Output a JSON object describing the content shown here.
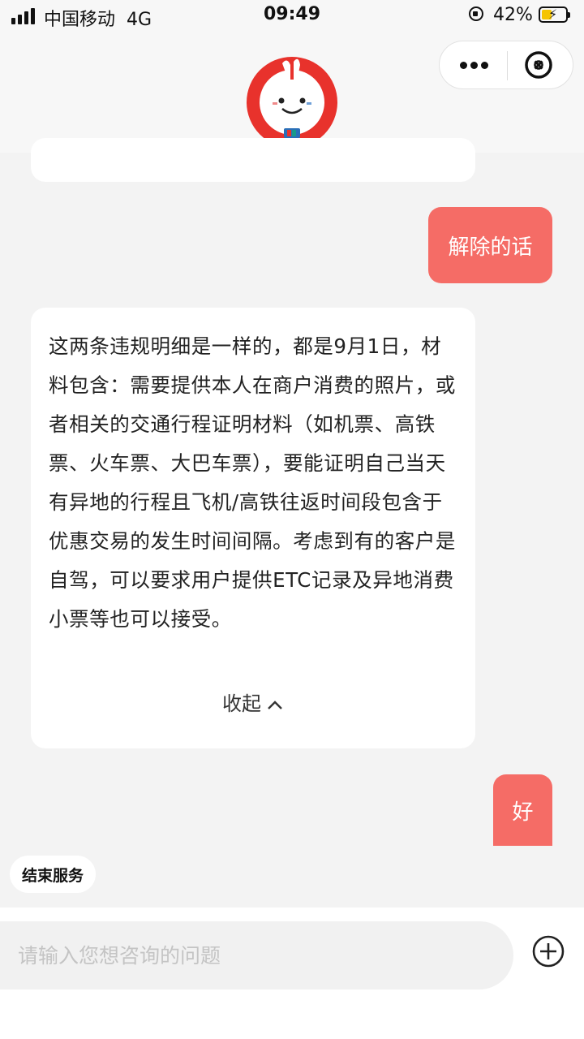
{
  "status_bar": {
    "carrier": "中国移动",
    "network": "4G",
    "time": "09:49",
    "battery_percent": "42%",
    "battery_level": 0.42
  },
  "header": {
    "more_icon": "more-dots-icon",
    "close_icon": "close-circle-icon",
    "avatar": "mascot-avatar"
  },
  "messages": [
    {
      "role": "user",
      "text": "解除的话"
    },
    {
      "role": "bot",
      "text": "这两条违规明细是一样的，都是9月1日，材料包含：需要提供本人在商户消费的照片，或者相关的交通行程证明材料（如机票、高铁票、火车票、大巴车票），要能证明自己当天有异地的行程且飞机/高铁往返时间段包含于优惠交易的发生时间间隔。考虑到有的客户是自驾，可以要求用户提供ETC记录及异地消费小票等也可以接受。",
      "collapse_label": "收起"
    },
    {
      "role": "user",
      "text": "好"
    }
  ],
  "end_service_label": "结束服务",
  "input": {
    "placeholder": "请输入您想咨询的问题"
  },
  "colors": {
    "user_bubble": "#f56c66",
    "background": "#f3f3f3"
  }
}
